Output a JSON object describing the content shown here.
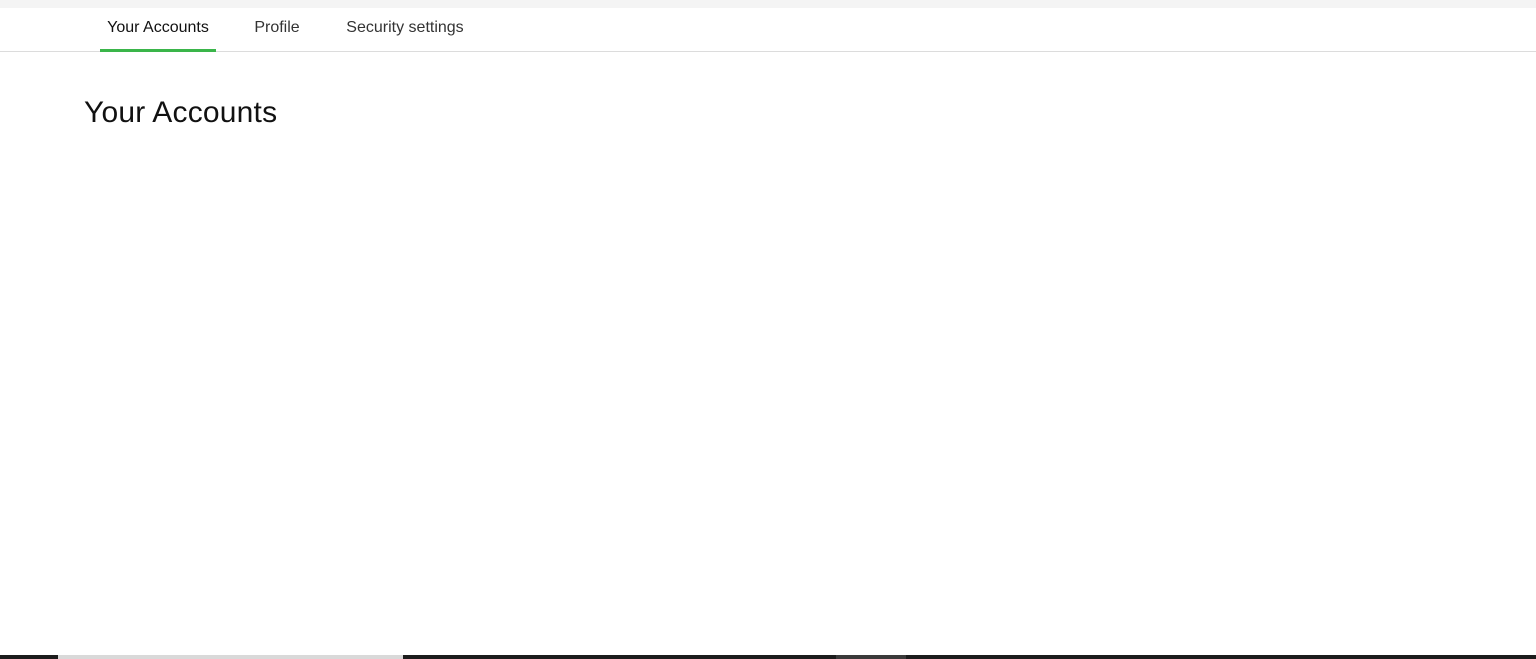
{
  "tabs": [
    {
      "label": "Your Accounts",
      "active": true
    },
    {
      "label": "Profile",
      "active": false
    },
    {
      "label": "Security settings",
      "active": false
    }
  ],
  "main": {
    "title": "Your Accounts"
  },
  "colors": {
    "accent": "#3ab54a",
    "text": "#111111",
    "divider": "#dcdcdc"
  }
}
